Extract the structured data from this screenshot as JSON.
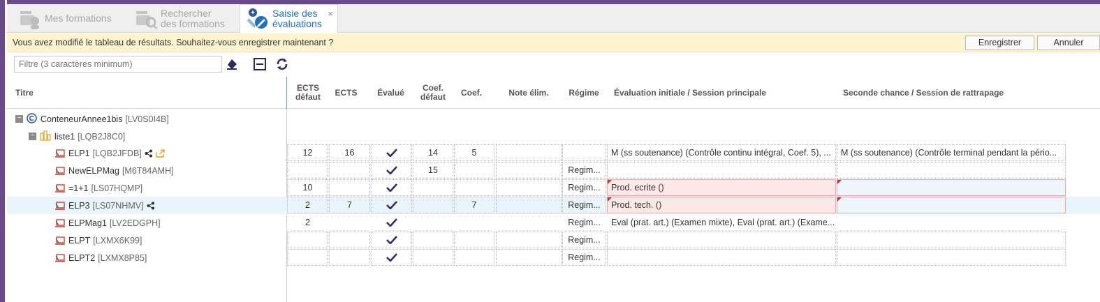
{
  "tabs": [
    {
      "label_l1": "Mes formations",
      "label_l2": "",
      "icon": "person-cap-icon",
      "active": false
    },
    {
      "label_l1": "Rechercher",
      "label_l2": "des formations",
      "icon": "search-formation-icon",
      "active": false
    },
    {
      "label_l1": "Saisie des",
      "label_l2": "évaluations",
      "icon": "edit-evaluation-icon",
      "active": true,
      "close": "×"
    }
  ],
  "notice": {
    "message": "Vous avez modifié le tableau de résultats. Souhaitez-vous enregistrer maintenant ?",
    "save_label": "Enregistrer",
    "cancel_label": "Annuler",
    "background": "#fcf3cf"
  },
  "toolbar": {
    "filter_placeholder": "Filtre (3 caractères minimum)",
    "icons": [
      "eraser-icon",
      "collapse-icon",
      "refresh-icon"
    ]
  },
  "columns": {
    "titre": "Titre",
    "ects_defaut_l1": "ECTS",
    "ects_defaut_l2": "défaut",
    "ects": "ECTS",
    "evalue": "Évalué",
    "coef_defaut_l1": "Coef.",
    "coef_defaut_l2": "défaut",
    "coef": "Coef.",
    "note_elim": "Note élim.",
    "regime": "Régime",
    "eval_initiale": "Évaluation initiale / Session principale",
    "seconde_chance": "Seconde chance / Session de rattrapage"
  },
  "tree": [
    {
      "name": "ConteneurAnnee1bis",
      "code": "[LV0S0I4B]",
      "icon": "copyright-circle-icon",
      "toggle": "−"
    },
    {
      "name": "liste1",
      "code": "[LQB2J8C0]",
      "icon": "list-icon",
      "toggle": "−"
    }
  ],
  "rows": [
    {
      "name": "ELP1",
      "code": "[LQB2JFDB]",
      "share": true,
      "export": true,
      "ects_defaut": "12",
      "ects": "16",
      "evalue": true,
      "coef_defaut": "14",
      "coef": "5",
      "note_elim": "",
      "regime": "",
      "eval_initiale": "M (ss soutenance) (Contrôle continu intégral, Coef. 5), ...",
      "seconde_chance": "M (ss soutenance) (Contrôle terminal pendant la pério...",
      "err": false
    },
    {
      "name": "NewELPMag",
      "code": "[M6T84AMH]",
      "share": false,
      "export": false,
      "ects_defaut": "",
      "ects": "",
      "evalue": true,
      "coef_defaut": "15",
      "coef": "",
      "note_elim": "",
      "regime": "Regim...",
      "eval_initiale": "",
      "seconde_chance": "",
      "err": false
    },
    {
      "name": "=1+1",
      "code": "[LS07HQMP]",
      "share": false,
      "export": false,
      "ects_defaut": "10",
      "ects": "",
      "evalue": true,
      "coef_defaut": "",
      "coef": "",
      "note_elim": "",
      "regime": "Regim...",
      "eval_initiale": "Prod. ecrite ()",
      "seconde_chance": "",
      "err": true
    },
    {
      "name": "ELP3",
      "code": "[LS07NHMV]",
      "share": true,
      "export": false,
      "ects_defaut": "2",
      "ects": "7",
      "evalue": true,
      "coef_defaut": "",
      "coef": "7",
      "note_elim": "",
      "regime": "Regim...",
      "eval_initiale": "Prod. tech. ()",
      "seconde_chance": "",
      "err": true,
      "highlight": true
    },
    {
      "name": "ELPMag1",
      "code": "[LV2EDGPH]",
      "share": false,
      "export": false,
      "ects_defaut": "2",
      "ects": "",
      "evalue": true,
      "coef_defaut": "",
      "coef": "",
      "note_elim": "",
      "regime": "Regim...",
      "eval_initiale": "Eval (prat. art.) (Examen mixte), Eval (prat. art.) (Exame...",
      "seconde_chance": "",
      "err": false,
      "noborder": true
    },
    {
      "name": "ELPT",
      "code": "[LXMX6K99]",
      "share": false,
      "export": false,
      "ects_defaut": "",
      "ects": "",
      "evalue": true,
      "coef_defaut": "",
      "coef": "",
      "note_elim": "",
      "regime": "Regim...",
      "eval_initiale": "",
      "seconde_chance": "",
      "err": false
    },
    {
      "name": "ELPT2",
      "code": "[LXMX8P85]",
      "share": false,
      "export": false,
      "ects_defaut": "",
      "ects": "",
      "evalue": true,
      "coef_defaut": "",
      "coef": "",
      "note_elim": "",
      "regime": "Regim...",
      "eval_initiale": "",
      "seconde_chance": "",
      "err": false
    }
  ],
  "colors": {
    "accent": "#1e73be",
    "check": "#3b2a6b",
    "error_bg": "#fde7e7",
    "error_mark": "#c0392b",
    "frame": "#6b4a8c"
  }
}
